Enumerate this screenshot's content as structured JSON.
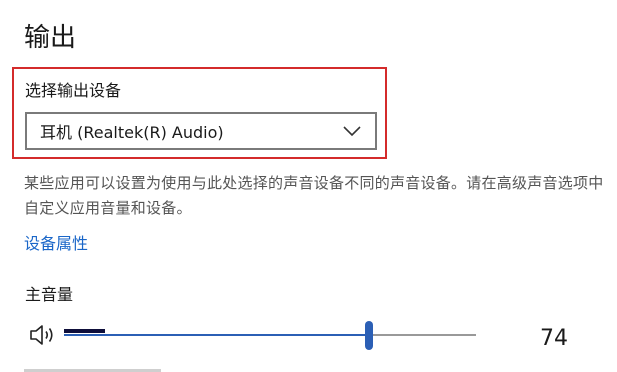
{
  "section": {
    "title": "输出"
  },
  "output_device": {
    "label": "选择输出设备",
    "selected": "耳机 (Realtek(R) Audio)",
    "highlight_color": "#d42b2b"
  },
  "description": "某些应用可以设置为使用与此处选择的声音设备不同的声音设备。请在高级声音选项中自定义应用音量和设备。",
  "device_properties_link": "设备属性",
  "master_volume": {
    "label": "主音量",
    "value": "74",
    "level_percent": 74,
    "peak_percent": 10,
    "icon": "speaker-icon",
    "accent_color": "#2b5fb5"
  }
}
